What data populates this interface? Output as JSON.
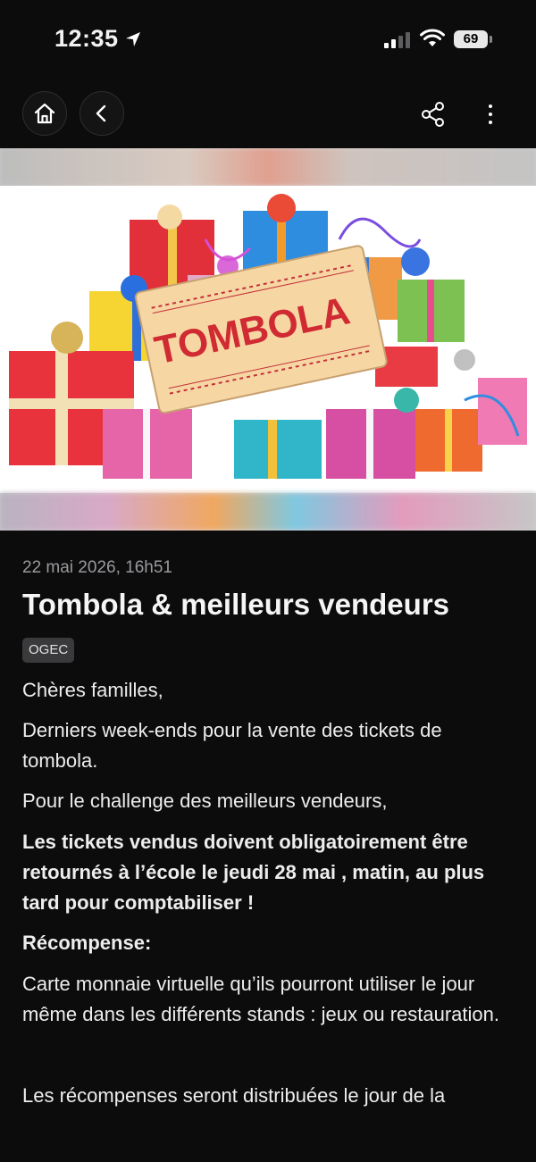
{
  "status_bar": {
    "time": "12:35",
    "battery": "69"
  },
  "hero": {
    "ticket_text": "TOMBOLA"
  },
  "article": {
    "date": "22 mai 2026, 16h51",
    "title": "Tombola & meilleurs vendeurs",
    "tag": "OGEC",
    "paragraphs": [
      "Chères familles,",
      "Derniers week-ends pour la vente des tickets de tombola.",
      "Pour le challenge des meilleurs vendeurs,",
      "Les tickets vendus doivent obligatoirement être retournés à l’école le jeudi 28 mai , matin, au plus tard pour comptabiliser !",
      "Récompense:",
      "Carte monnaie virtuelle qu’ils pourront utiliser le jour même dans les différents stands : jeux ou restauration.",
      "Les récompenses seront distribuées le jour de la"
    ]
  },
  "icons": {
    "home": "home-icon",
    "back": "chevron-left-icon",
    "share": "share-icon",
    "more": "more-vertical-icon",
    "location": "location-arrow-icon",
    "signal": "cellular-signal-icon",
    "wifi": "wifi-icon",
    "battery": "battery-icon"
  }
}
